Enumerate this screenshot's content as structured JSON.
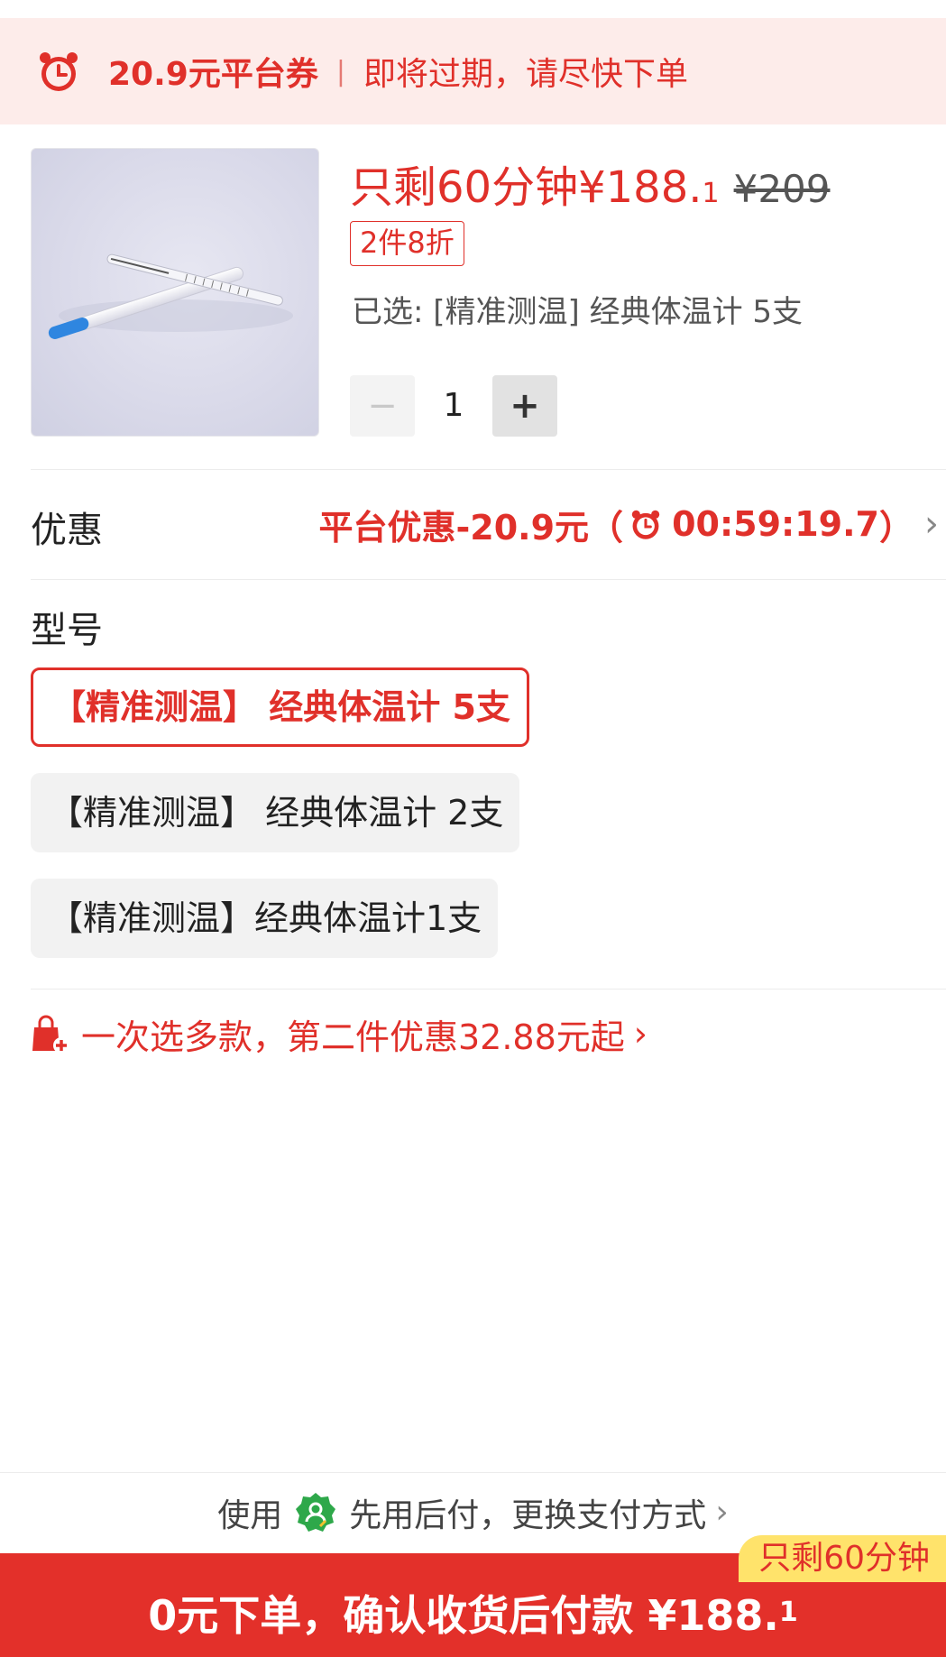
{
  "banner": {
    "coupon_amount": "20.9元平台券",
    "separator": "|",
    "message": "即将过期，请尽快下单"
  },
  "product": {
    "promo_price": "只剩60分钟¥188.",
    "promo_price_decimal": "1",
    "original_price": "¥209",
    "discount_tag": "2件8折",
    "selected_text": "已选: [精准测温] 经典体温计 5支",
    "quantity_minus": "−",
    "quantity": "1",
    "quantity_plus": "+"
  },
  "discount": {
    "label": "优惠",
    "value_prefix": "平台优惠-20.9元（",
    "countdown": "00:59:19.7",
    "value_suffix": "）",
    "chevron": "›"
  },
  "model": {
    "label": "型号",
    "options": [
      {
        "label": "【精准测温】 经典体温计 5支",
        "selected": true
      },
      {
        "label": "【精准测温】 经典体温计 2支",
        "selected": false
      },
      {
        "label": "【精准测温】经典体温计1支",
        "selected": false
      }
    ]
  },
  "multi_buy": {
    "text": "一次选多款，第二件优惠32.88元起",
    "chevron": "›"
  },
  "payment": {
    "prefix": "使用",
    "text": "先用后付，更换支付方式",
    "chevron": "›"
  },
  "cta": {
    "label": "0元下单，确认收货后付款 ¥188.",
    "label_decimal": "1",
    "badge": "只剩60分钟"
  },
  "colors": {
    "accent": "#e0302a",
    "banner_bg": "#fdecea",
    "badge_bg": "#ffe36b",
    "pay_icon": "#2ea84a"
  },
  "icons": {
    "banner": "alarm-clock-icon",
    "countdown": "alarm-clock-icon",
    "multi_buy": "shopping-bag-plus-icon",
    "payment": "pay-later-shield-icon"
  }
}
